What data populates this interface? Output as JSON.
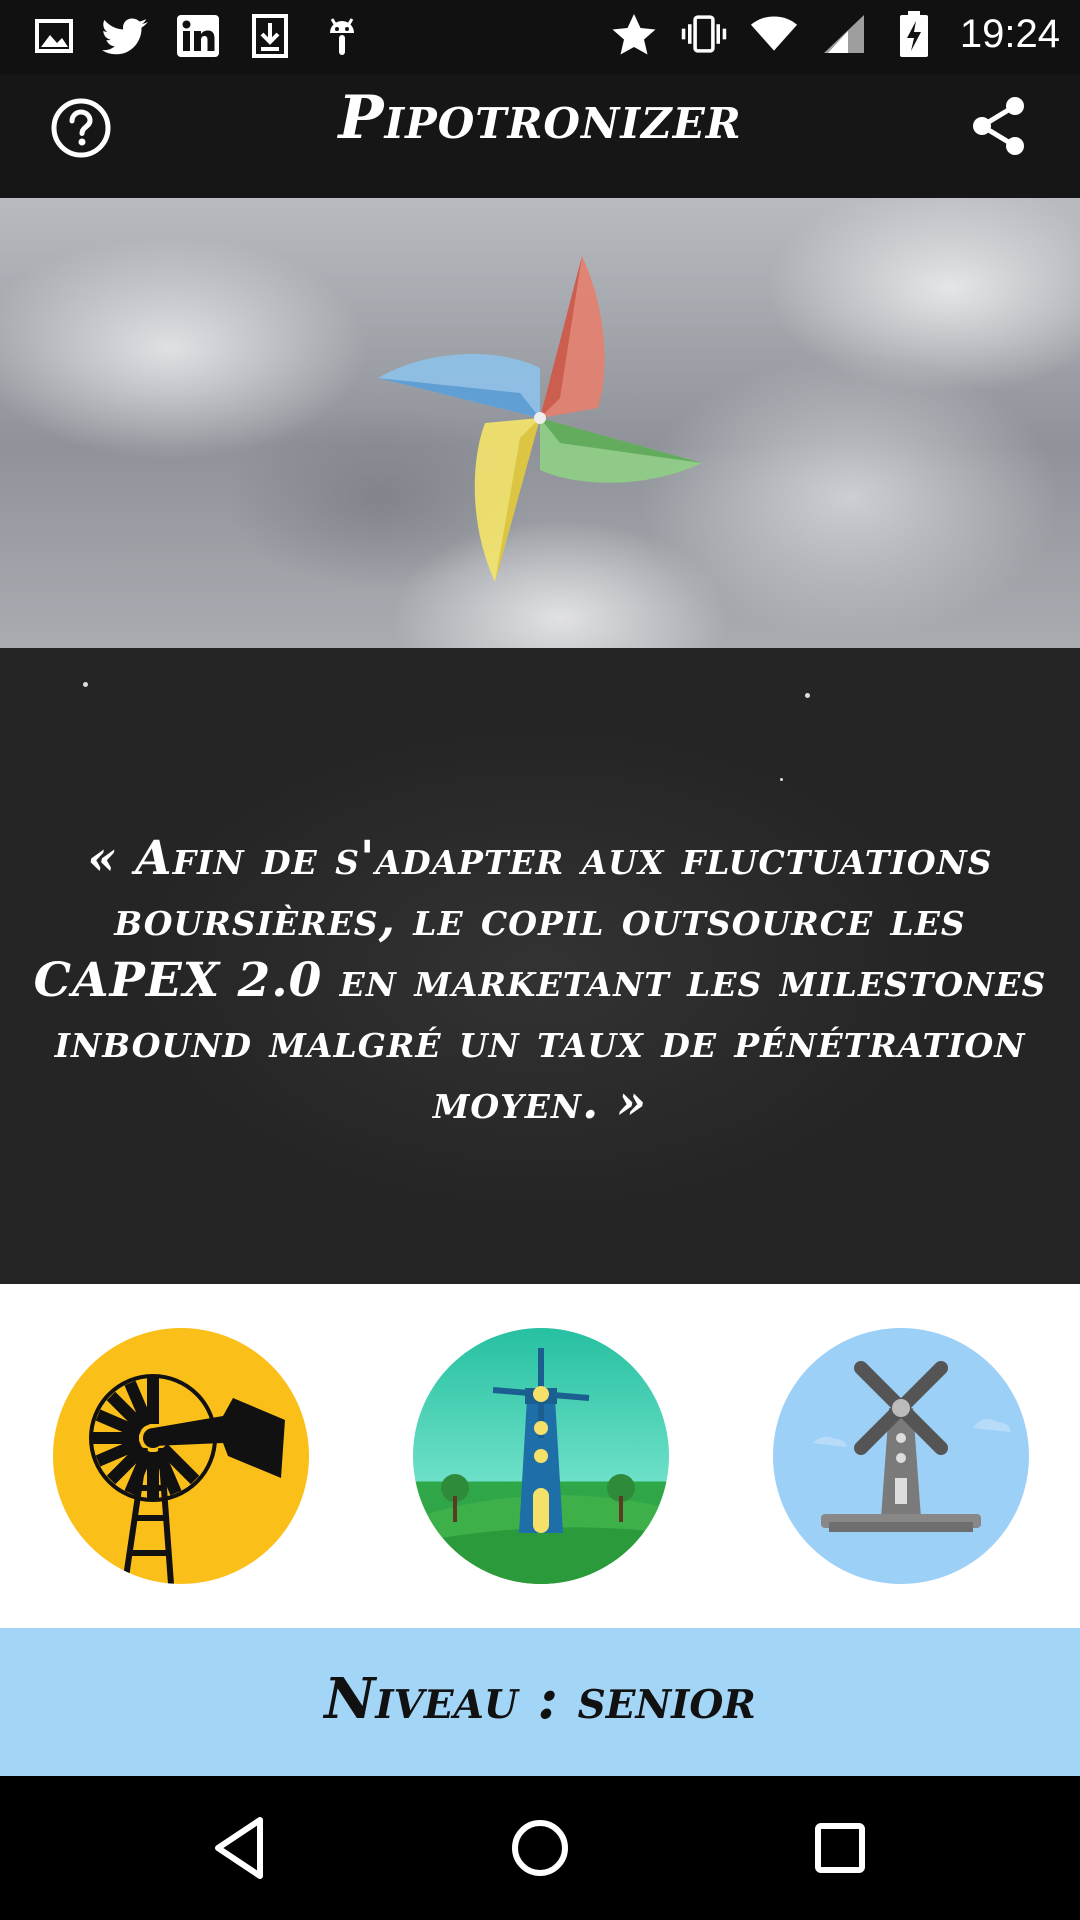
{
  "status_bar": {
    "time": "19:24",
    "left_icons": [
      "gallery-icon",
      "twitter-icon",
      "linkedin-icon",
      "download-icon",
      "android-icon"
    ],
    "right_icons": [
      "star-icon",
      "vibrate-icon",
      "wifi-icon",
      "signal-icon",
      "battery-charging-icon"
    ]
  },
  "app_bar": {
    "title": "Pipotronizer",
    "left_icon": "help-icon",
    "right_icon": "share-icon"
  },
  "quote": {
    "text": "« Afin de s'adapter aux fluctuations boursières, le copil outsource les CAPEX 2.0 en marketant les milestones inbound malgré un taux de pénétration moyen. »"
  },
  "levels": {
    "options": [
      {
        "icon": "windpump-icon",
        "color": "#fbbf1a"
      },
      {
        "icon": "windmill-tower-icon",
        "color": "#26c0a0"
      },
      {
        "icon": "windmill-icon",
        "color": "#9cd0f7"
      }
    ]
  },
  "niveau": {
    "label": "Niveau : senior",
    "background": "#a2d5f6"
  },
  "nav_bar": {
    "icons": [
      "back-icon",
      "home-icon",
      "recents-icon"
    ]
  },
  "colors": {
    "appbar": "#161616",
    "statusbar": "#111111",
    "chalkboard": "#252525"
  }
}
